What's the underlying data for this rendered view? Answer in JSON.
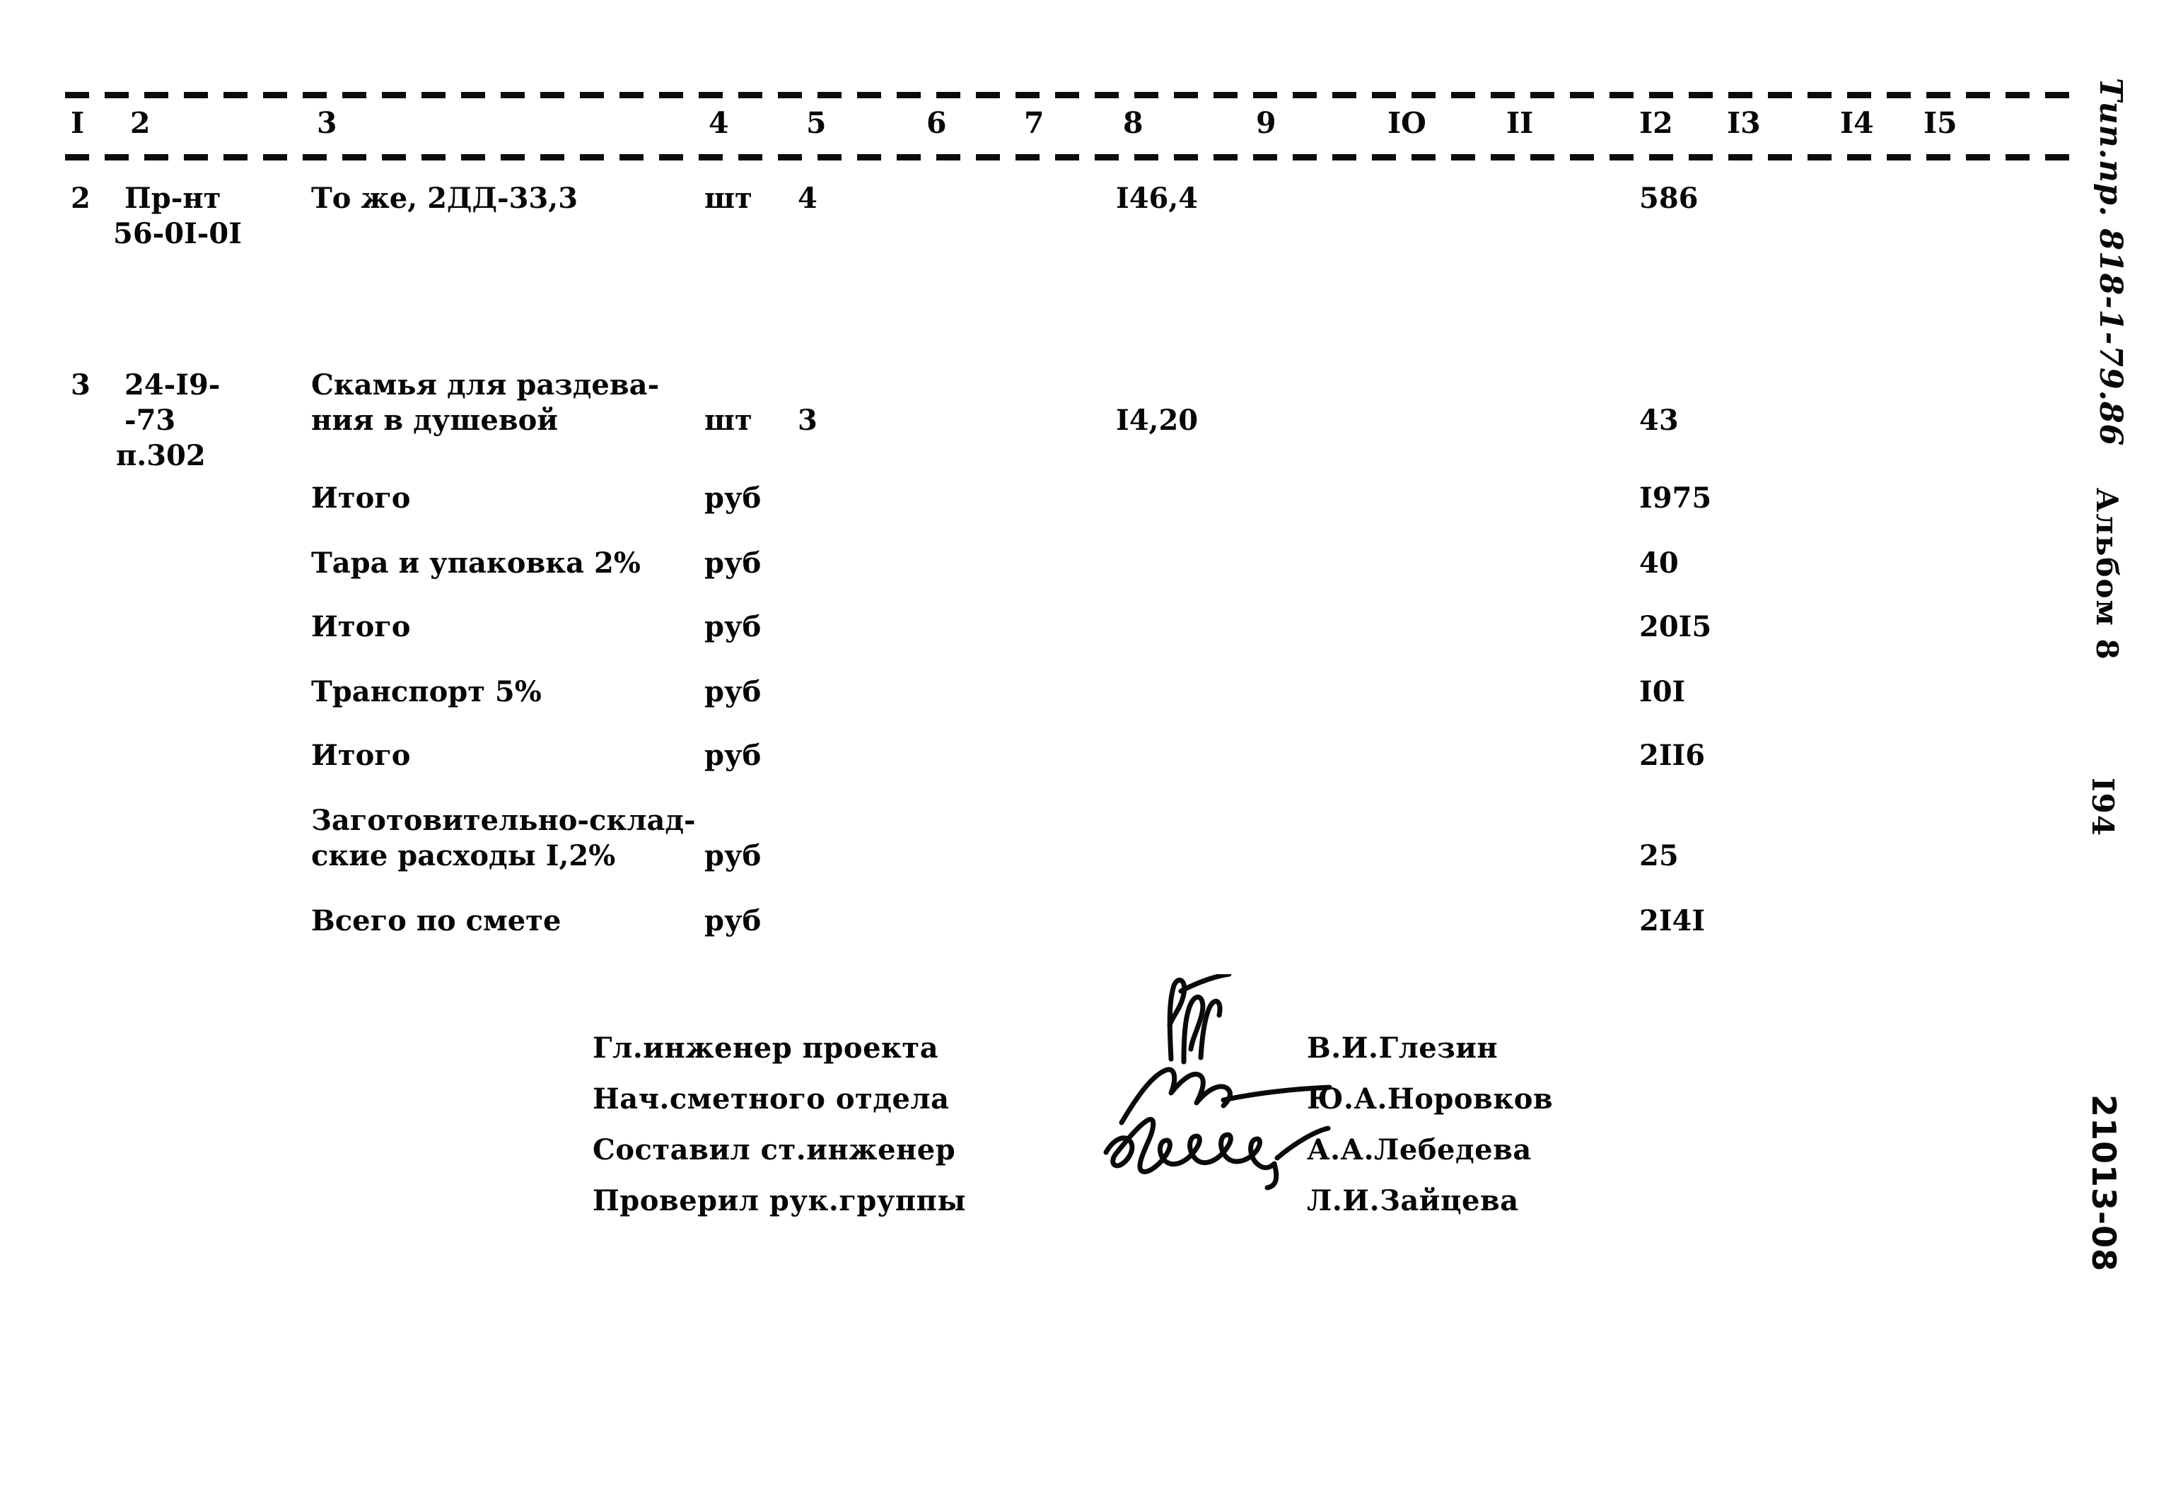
{
  "document": {
    "type": "construction-estimate-sheet",
    "page_number": "I94",
    "margin_note_handwritten": "Тип.пр. 818-1-79.86",
    "margin_note_album": "Альбом 8",
    "margin_code": "21013-08"
  },
  "table": {
    "column_headers": [
      "I",
      "2",
      "3",
      "4",
      "5",
      "6",
      "7",
      "8",
      "9",
      "IO",
      "II",
      "I2",
      "I3",
      "I4",
      "I5"
    ],
    "rows": [
      {
        "num": "2",
        "code_line1": "Пр-нт",
        "code_line2": "56-0I-0I",
        "code_line3": "",
        "name_line1": "То же, 2ДД-33,3",
        "name_line2": "",
        "unit": "шт",
        "qty": "4",
        "price": "I46,4",
        "total": "586"
      },
      {
        "num": "3",
        "code_line1": "24-I9-",
        "code_line2": "-73",
        "code_line3": "п.302",
        "name_line1": "Скамья для раздева-",
        "name_line2": "ния в душевой",
        "unit": "шт",
        "qty": "3",
        "price": "I4,20",
        "total": "43"
      }
    ],
    "summary": [
      {
        "label_line1": "Итого",
        "label_line2": "",
        "unit": "руб",
        "total": "I975"
      },
      {
        "label_line1": "Тара и упаковка 2%",
        "label_line2": "",
        "unit": "руб",
        "total": "40"
      },
      {
        "label_line1": "Итого",
        "label_line2": "",
        "unit": "руб",
        "total": "20I5"
      },
      {
        "label_line1": "Транспорт 5%",
        "label_line2": "",
        "unit": "руб",
        "total": "I0I"
      },
      {
        "label_line1": "Итого",
        "label_line2": "",
        "unit": "руб",
        "total": "2II6"
      },
      {
        "label_line1": "Заготовительно-склад-",
        "label_line2": "ские расходы I,2%",
        "unit": "руб",
        "total": "25"
      },
      {
        "label_line1": "Всего по смете",
        "label_line2": "",
        "unit": "руб",
        "total": "2I4I"
      }
    ]
  },
  "signatures": {
    "entries": [
      {
        "role": "Гл.инженер проекта",
        "name": "В.И.Глезин"
      },
      {
        "role": "Нач.сметного отдела",
        "name": "Ю.А.Норовков"
      },
      {
        "role": "Составил ст.инженер",
        "name": "А.А.Лебедева"
      },
      {
        "role": "Проверил рук.группы",
        "name": "Л.И.Зайцева"
      }
    ]
  }
}
